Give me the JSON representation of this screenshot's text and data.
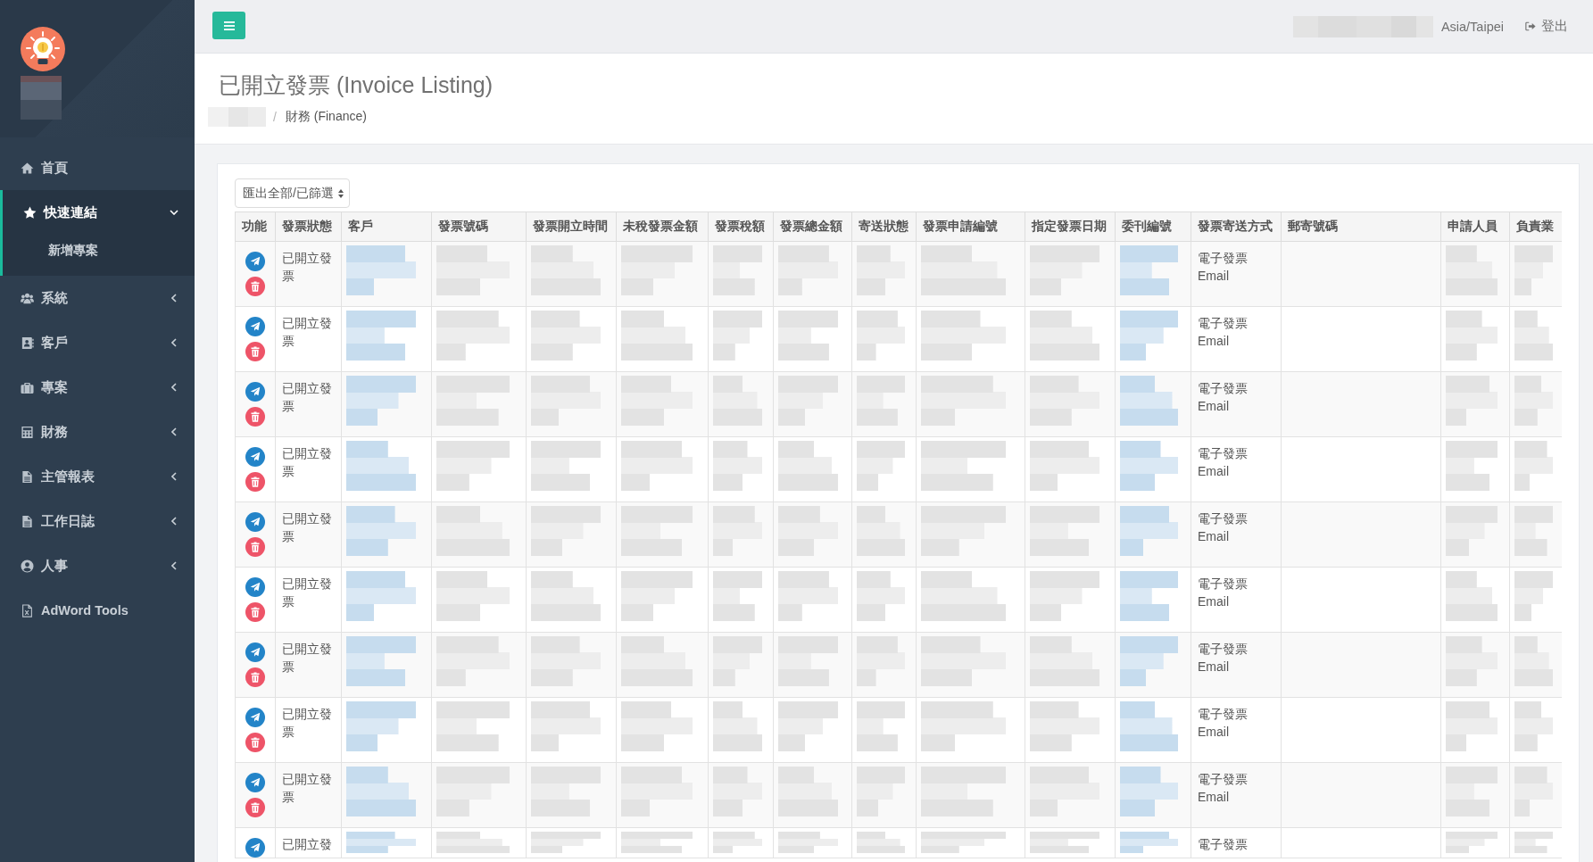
{
  "sidebar": {
    "profile": {
      "name_redacted": true
    },
    "menu": [
      {
        "label": "首頁",
        "kind": "link",
        "selected": false
      },
      {
        "label": "快速連結",
        "kind": "group",
        "selected": true,
        "expanded": true,
        "children": [
          {
            "label": "新增專案",
            "selected": false
          }
        ]
      },
      {
        "label": "系統",
        "kind": "group",
        "selected": false,
        "expanded": false
      },
      {
        "label": "客戶",
        "kind": "group",
        "selected": false,
        "expanded": false
      },
      {
        "label": "專案",
        "kind": "group",
        "selected": false,
        "expanded": false
      },
      {
        "label": "財務",
        "kind": "group",
        "selected": false,
        "expanded": false
      },
      {
        "label": "主管報表",
        "kind": "group",
        "selected": false,
        "expanded": false
      },
      {
        "label": "工作日誌",
        "kind": "group",
        "selected": false,
        "expanded": false
      },
      {
        "label": "人事",
        "kind": "group",
        "selected": false,
        "expanded": false
      },
      {
        "label": "AdWord Tools",
        "kind": "link",
        "selected": false
      }
    ]
  },
  "top_bar": {
    "user_redacted": true,
    "timezone": "Asia/Taipei",
    "logout": "登出"
  },
  "page_header": {
    "title": "已開立發票 (Invoice Listing)",
    "separator": "/",
    "breadcrumb": [
      {
        "kind": "redacted"
      },
      {
        "kind": "text",
        "label": "財務 (Finance)"
      }
    ]
  },
  "table": {
    "export_select": "匯出全部/已篩選",
    "columns": [
      {
        "label": "功能",
        "kind": "actions"
      },
      {
        "label": "發票狀態",
        "kind": "status"
      },
      {
        "label": "客戶",
        "kind": "link"
      },
      {
        "label": "發票號碼",
        "kind": "redacted"
      },
      {
        "label": "發票開立時間",
        "kind": "redacted"
      },
      {
        "label": "未稅發票金額",
        "kind": "redacted"
      },
      {
        "label": "發票稅額",
        "kind": "redacted"
      },
      {
        "label": "發票總金額",
        "kind": "redacted"
      },
      {
        "label": "寄送狀態",
        "kind": "redacted"
      },
      {
        "label": "發票申請編號",
        "kind": "redacted"
      },
      {
        "label": "指定發票日期",
        "kind": "redacted"
      },
      {
        "label": "委刊編號",
        "kind": "link"
      },
      {
        "label": "發票寄送方式",
        "kind": "delivery"
      },
      {
        "label": "郵寄號碼",
        "kind": "empty"
      },
      {
        "label": "申請人員",
        "kind": "redacted"
      },
      {
        "label": "負責業",
        "kind": "redacted"
      }
    ],
    "rows": [
      {
        "actions": [
          {
            "kind": "send"
          },
          {
            "kind": "delete"
          }
        ],
        "status": "已開立發票",
        "delivery": [
          "電子發票",
          "Email"
        ]
      },
      {
        "actions": [
          {
            "kind": "send"
          },
          {
            "kind": "delete"
          }
        ],
        "status": "已開立發票",
        "delivery": [
          "電子發票",
          "Email"
        ]
      },
      {
        "actions": [
          {
            "kind": "send"
          },
          {
            "kind": "delete"
          }
        ],
        "status": "已開立發票",
        "delivery": [
          "電子發票",
          "Email"
        ]
      },
      {
        "actions": [
          {
            "kind": "send"
          },
          {
            "kind": "delete"
          }
        ],
        "status": "已開立發票",
        "delivery": [
          "電子發票",
          "Email"
        ]
      },
      {
        "actions": [
          {
            "kind": "send"
          },
          {
            "kind": "delete"
          }
        ],
        "status": "已開立發票",
        "delivery": [
          "電子發票",
          "Email"
        ]
      },
      {
        "actions": [
          {
            "kind": "send"
          },
          {
            "kind": "delete"
          }
        ],
        "status": "已開立發票",
        "delivery": [
          "電子發票",
          "Email"
        ]
      },
      {
        "actions": [
          {
            "kind": "send"
          },
          {
            "kind": "delete"
          }
        ],
        "status": "已開立發票",
        "delivery": [
          "電子發票",
          "Email"
        ]
      },
      {
        "actions": [
          {
            "kind": "send"
          },
          {
            "kind": "delete"
          }
        ],
        "status": "已開立發票",
        "delivery": [
          "電子發票",
          "Email"
        ]
      },
      {
        "actions": [
          {
            "kind": "send"
          },
          {
            "kind": "delete"
          }
        ],
        "status": "已開立發票",
        "delivery": [
          "電子發票",
          "Email"
        ]
      },
      {
        "actions": [
          {
            "kind": "send"
          }
        ],
        "status": "已開立發",
        "delivery": [
          "電子發票"
        ]
      }
    ]
  }
}
